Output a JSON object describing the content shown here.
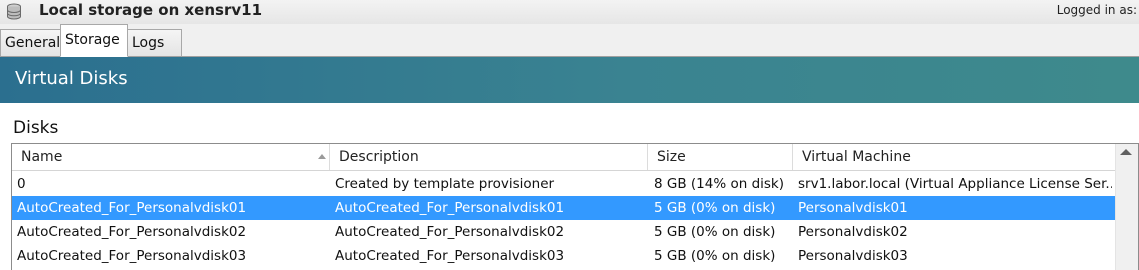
{
  "window": {
    "title": "Local storage on xensrv11",
    "title_icon": "storage-icon",
    "logged_in_text": "Logged in as:"
  },
  "tabs": [
    {
      "label": "General",
      "active": false
    },
    {
      "label": "Storage",
      "active": true
    },
    {
      "label": "Logs",
      "active": false
    }
  ],
  "header": {
    "title": "Virtual Disks"
  },
  "disks": {
    "label": "Disks",
    "sort": {
      "column": "Name",
      "direction": "ascending"
    },
    "columns": [
      "Name",
      "Description",
      "Size",
      "Virtual Machine"
    ],
    "rows": [
      {
        "name": "0",
        "description": "Created by template provisioner",
        "size": "8 GB (14% on disk)",
        "vm": "srv1.labor.local (Virtual Appliance License Ser...",
        "selected": false
      },
      {
        "name": "AutoCreated_For_Personalvdisk01",
        "description": "AutoCreated_For_Personalvdisk01",
        "size": "5 GB (0% on disk)",
        "vm": "Personalvdisk01",
        "selected": true
      },
      {
        "name": "AutoCreated_For_Personalvdisk02",
        "description": "AutoCreated_For_Personalvdisk02",
        "size": "5 GB (0% on disk)",
        "vm": "Personalvdisk02",
        "selected": false
      },
      {
        "name": "AutoCreated_For_Personalvdisk03",
        "description": "AutoCreated_For_Personalvdisk03",
        "size": "5 GB (0% on disk)",
        "vm": "Personalvdisk03",
        "selected": false
      }
    ]
  },
  "colors": {
    "header_band_start": "#2b6f8f",
    "header_band_end": "#3e8a8c",
    "selection": "#3399ff"
  }
}
